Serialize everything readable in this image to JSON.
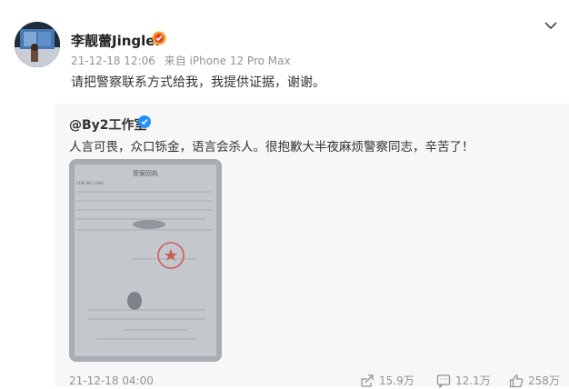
{
  "post": {
    "author": "李靓蕾Jinglei",
    "timestamp": "21-12-18 12:06",
    "source": "来自 iPhone 12 Pro Max",
    "text": "请把警察联系方式给我，我提供证据，谢谢。"
  },
  "repost": {
    "author": "@By2工作室",
    "text": "人言可畏，众口铄金，语言会杀人。很抱歉大半夜麻烦警察同志，辛苦了！",
    "image": {
      "header": "受案回执",
      "name_line": "YUN BEI LING"
    },
    "timestamp": "21-12-18 04:00",
    "shares": "15.9万",
    "comments": "12.1万",
    "likes": "258万"
  },
  "icons": {
    "avatar": "avatar",
    "verify": "verify-badge-icon",
    "chevron": "chevron-down-icon",
    "share": "share-icon",
    "comment": "comment-icon",
    "like": "like-icon"
  },
  "colors": {
    "verify_gold": "#f5a623",
    "verify_blue": "#1e90ff",
    "meta_gray": "#939393",
    "repost_bg": "#f7f7f7",
    "stamp_red": "#d23a34"
  }
}
